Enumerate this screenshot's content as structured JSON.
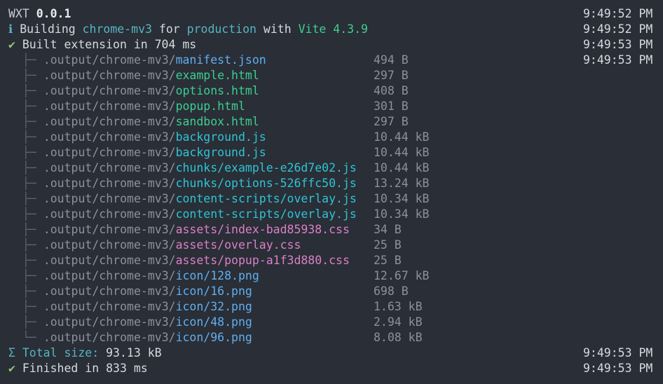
{
  "header": {
    "app": "WXT",
    "version": "0.0.1",
    "time": "9:49:52 PM"
  },
  "building": {
    "icon": "ℹ",
    "prefix": "Building ",
    "target": "chrome-mv3",
    "mid1": " for ",
    "mode": "production",
    "mid2": " with ",
    "tool": "Vite 4.3.9",
    "time": "9:49:52 PM"
  },
  "built": {
    "icon": "✔",
    "text": "Built extension in 704 ms",
    "time": "9:49:53 PM"
  },
  "files": [
    {
      "branch": "├─",
      "dir": ".output/chrome-mv3/",
      "name": "manifest.json",
      "size": "494 B",
      "color": "blue",
      "time": "9:49:53 PM"
    },
    {
      "branch": "├─",
      "dir": ".output/chrome-mv3/",
      "name": "example.html",
      "size": "297 B",
      "color": "green",
      "time": ""
    },
    {
      "branch": "├─",
      "dir": ".output/chrome-mv3/",
      "name": "options.html",
      "size": "408 B",
      "color": "green",
      "time": ""
    },
    {
      "branch": "├─",
      "dir": ".output/chrome-mv3/",
      "name": "popup.html",
      "size": "301 B",
      "color": "green",
      "time": ""
    },
    {
      "branch": "├─",
      "dir": ".output/chrome-mv3/",
      "name": "sandbox.html",
      "size": "297 B",
      "color": "green",
      "time": ""
    },
    {
      "branch": "├─",
      "dir": ".output/chrome-mv3/",
      "name": "background.js",
      "size": "10.44 kB",
      "color": "cyan",
      "time": ""
    },
    {
      "branch": "├─",
      "dir": ".output/chrome-mv3/",
      "name": "background.js",
      "size": "10.44 kB",
      "color": "cyan",
      "time": ""
    },
    {
      "branch": "├─",
      "dir": ".output/chrome-mv3/",
      "name": "chunks/example-e26d7e02.js",
      "size": "10.44 kB",
      "color": "cyan",
      "time": ""
    },
    {
      "branch": "├─",
      "dir": ".output/chrome-mv3/",
      "name": "chunks/options-526ffc50.js",
      "size": "13.24 kB",
      "color": "cyan",
      "time": ""
    },
    {
      "branch": "├─",
      "dir": ".output/chrome-mv3/",
      "name": "content-scripts/overlay.js",
      "size": "10.34 kB",
      "color": "cyan",
      "time": ""
    },
    {
      "branch": "├─",
      "dir": ".output/chrome-mv3/",
      "name": "content-scripts/overlay.js",
      "size": "10.34 kB",
      "color": "cyan",
      "time": ""
    },
    {
      "branch": "├─",
      "dir": ".output/chrome-mv3/",
      "name": "assets/index-bad85938.css",
      "size": "34 B",
      "color": "pink",
      "time": ""
    },
    {
      "branch": "├─",
      "dir": ".output/chrome-mv3/",
      "name": "assets/overlay.css",
      "size": "25 B",
      "color": "pink",
      "time": ""
    },
    {
      "branch": "├─",
      "dir": ".output/chrome-mv3/",
      "name": "assets/popup-a1f3d880.css",
      "size": "25 B",
      "color": "pink",
      "time": ""
    },
    {
      "branch": "├─",
      "dir": ".output/chrome-mv3/",
      "name": "icon/128.png",
      "size": "12.67 kB",
      "color": "blue",
      "time": ""
    },
    {
      "branch": "├─",
      "dir": ".output/chrome-mv3/",
      "name": "icon/16.png",
      "size": "698 B",
      "color": "blue",
      "time": ""
    },
    {
      "branch": "├─",
      "dir": ".output/chrome-mv3/",
      "name": "icon/32.png",
      "size": "1.63 kB",
      "color": "blue",
      "time": ""
    },
    {
      "branch": "├─",
      "dir": ".output/chrome-mv3/",
      "name": "icon/48.png",
      "size": "2.94 kB",
      "color": "blue",
      "time": ""
    },
    {
      "branch": "└─",
      "dir": ".output/chrome-mv3/",
      "name": "icon/96.png",
      "size": "8.08 kB",
      "color": "blue",
      "time": ""
    }
  ],
  "total": {
    "icon": "Σ",
    "label": "Total size:",
    "value": " 93.13 kB",
    "time": "9:49:53 PM"
  },
  "finished": {
    "icon": "✔",
    "text": "Finished in 833 ms",
    "time": "9:49:53 PM"
  },
  "colors": {
    "background": "#2a2e36",
    "blue": "#61afef",
    "green": "#3ccf91",
    "cyan": "#2ec4d6",
    "pink": "#d980c9",
    "info": "#56b6c2",
    "success": "#98c379"
  }
}
